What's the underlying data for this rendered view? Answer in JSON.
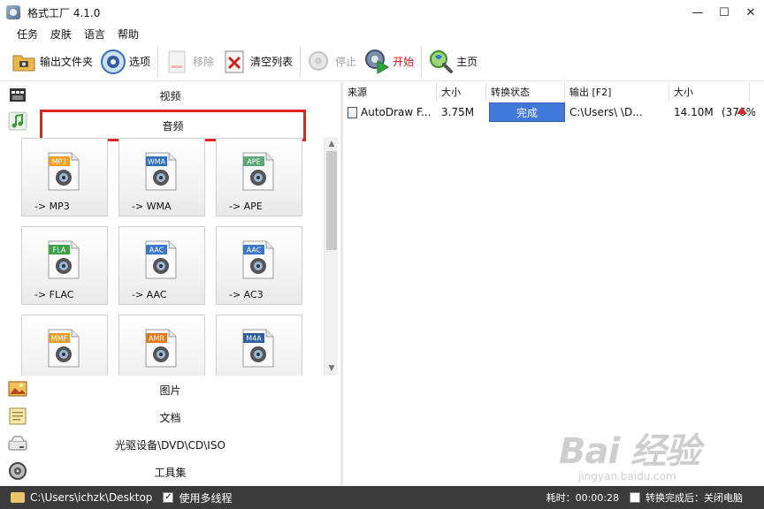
{
  "window": {
    "title": "格式工厂 4.1.0",
    "controls": {
      "minimize": "—",
      "maximize": "☐",
      "close": "✕"
    }
  },
  "menu": [
    "任务",
    "皮肤",
    "语言",
    "帮助"
  ],
  "toolbar": {
    "output_folder": "输出文件夹",
    "options": "选项",
    "remove": "移除",
    "clear_list": "清空列表",
    "stop": "停止",
    "start": "开始",
    "home": "主页"
  },
  "categories": {
    "video": "视频",
    "audio": "音频",
    "image": "图片",
    "document": "文档",
    "disc": "光驱设备\\DVD\\CD\\ISO",
    "tools": "工具集"
  },
  "formats": [
    {
      "tag": "MP3",
      "label": "-> MP3",
      "color": "#f0a020"
    },
    {
      "tag": "WMA",
      "label": "-> WMA",
      "color": "#2f6fb8"
    },
    {
      "tag": "APE",
      "label": "-> APE",
      "color": "#5aa878"
    },
    {
      "tag": "FLA",
      "label": "-> FLAC",
      "color": "#3aa34a"
    },
    {
      "tag": "AAC",
      "label": "-> AAC",
      "color": "#3a76c8"
    },
    {
      "tag": "AAC",
      "label": "-> AC3",
      "color": "#3a76c8"
    },
    {
      "tag": "MMF",
      "label": "",
      "color": "#e0a030"
    },
    {
      "tag": "AMR",
      "label": "",
      "color": "#e07a20"
    },
    {
      "tag": "M4A",
      "label": "",
      "color": "#2c5f9e"
    }
  ],
  "table": {
    "headers": [
      "来源",
      "大小",
      "转换状态",
      "输出 [F2]",
      "大小"
    ],
    "rows": [
      {
        "source": "AutoDraw F...",
        "size": "3.75M",
        "status": "完成",
        "output": "C:\\Users\\     \\D...",
        "out_size": "14.10M",
        "ratio": "(376%)"
      }
    ]
  },
  "statusbar": {
    "path": "C:\\Users\\ichzk\\Desktop",
    "multithread": "使用多线程",
    "elapsed": "耗时：00:00:28",
    "after_done": "转换完成后：关闭电脑"
  },
  "watermark": {
    "main": "Bai 经验",
    "sub": "jingyan.baidu.com"
  }
}
